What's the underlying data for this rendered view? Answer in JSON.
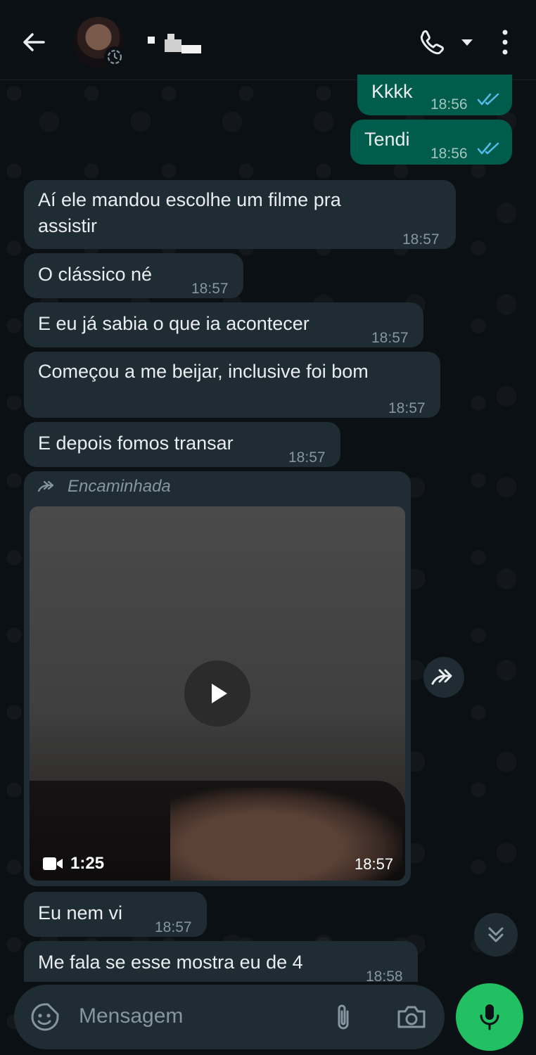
{
  "header": {
    "contact_name": "▪ ▪▪▪",
    "icons": [
      "back-arrow-icon",
      "status-ring-icon",
      "phone-icon",
      "dropdown-icon",
      "more-vert-icon"
    ]
  },
  "messages": [
    {
      "dir": "out",
      "text": "Kkkk",
      "time": "18:56",
      "status": "read"
    },
    {
      "dir": "out",
      "text": "Tendi",
      "time": "18:56",
      "status": "read"
    },
    {
      "dir": "in",
      "text": "Aí ele mandou escolhe um filme pra assistir",
      "time": "18:57"
    },
    {
      "dir": "in",
      "text": "O clássico né",
      "time": "18:57"
    },
    {
      "dir": "in",
      "text": "E eu já sabia o que ia acontecer",
      "time": "18:57"
    },
    {
      "dir": "in",
      "text": "Começou a me beijar, inclusive foi bom",
      "time": "18:57"
    },
    {
      "dir": "in",
      "text": "E depois fomos transar",
      "time": "18:57"
    },
    {
      "dir": "in",
      "text": "Eu nem vi",
      "time": "18:57"
    },
    {
      "dir": "in",
      "text": "Me fala se esse mostra eu de 4",
      "time": "18:58"
    }
  ],
  "video_message": {
    "forwarded_label": "Encaminhada",
    "duration": "1:25",
    "time": "18:57"
  },
  "composer": {
    "placeholder": "Mensagem"
  },
  "colors": {
    "background": "#0b1014",
    "incoming_bubble": "#1f2c33",
    "outgoing_bubble": "#005c4b",
    "read_ticks": "#53bdeb",
    "mic_button": "#21c063"
  }
}
